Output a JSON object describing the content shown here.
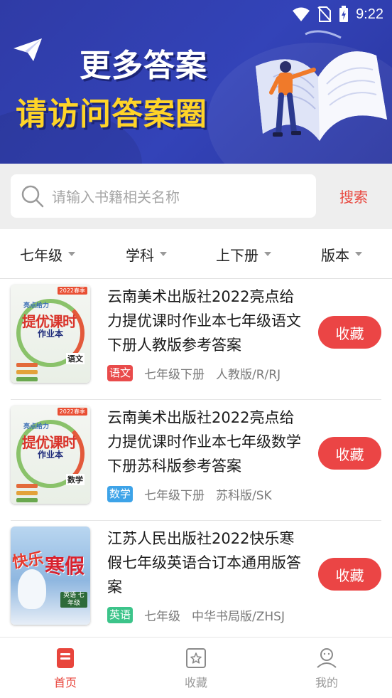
{
  "status_bar": {
    "time": "9:22",
    "icons": [
      "wifi-icon",
      "no-sim-icon",
      "battery-charging-icon"
    ]
  },
  "banner": {
    "line1": "更多答案",
    "line2": "请访问答案圈",
    "icon": "paper-plane-icon"
  },
  "search": {
    "placeholder": "请输入书籍相关名称",
    "button_label": "搜索"
  },
  "filters": [
    {
      "label": "七年级"
    },
    {
      "label": "学科"
    },
    {
      "label": "上下册"
    },
    {
      "label": "版本"
    }
  ],
  "books": [
    {
      "title": "云南美术出版社2022亮点给力提优课时作业本七年级语文下册人教版参考答案",
      "subject": "语文",
      "subject_color": "#e94b4b",
      "grade": "七年级下册",
      "edition": "人教版/R/RJ",
      "fav_label": "收藏",
      "cover": {
        "badge": "2022春季",
        "t1": "亮点给力",
        "t2": "提优课时",
        "t3": "作业本",
        "subject": "语文"
      }
    },
    {
      "title": "云南美术出版社2022亮点给力提优课时作业本七年级数学下册苏科版参考答案",
      "subject": "数学",
      "subject_color": "#3da3e8",
      "grade": "七年级下册",
      "edition": "苏科版/SK",
      "fav_label": "收藏",
      "cover": {
        "badge": "2022春季",
        "t1": "亮点给力",
        "t2": "提优课时",
        "t3": "作业本",
        "subject": "数学"
      }
    },
    {
      "title": "江苏人民出版社2022快乐寒假七年级英语合订本通用版答案",
      "subject": "英语",
      "subject_color": "#3cc48a",
      "grade": "七年级",
      "edition": "中华书局版/ZHSJ",
      "fav_label": "收藏",
      "cover": {
        "w1": "快乐",
        "w2": "寒假",
        "label": "英语 七年级"
      }
    }
  ],
  "bottom_nav": [
    {
      "label": "首页",
      "icon": "home-book-icon",
      "active": true,
      "color": "#e8453c"
    },
    {
      "label": "收藏",
      "icon": "star-box-icon",
      "active": false,
      "color": "#9a9a9a"
    },
    {
      "label": "我的",
      "icon": "user-icon",
      "active": false,
      "color": "#9a9a9a"
    }
  ]
}
